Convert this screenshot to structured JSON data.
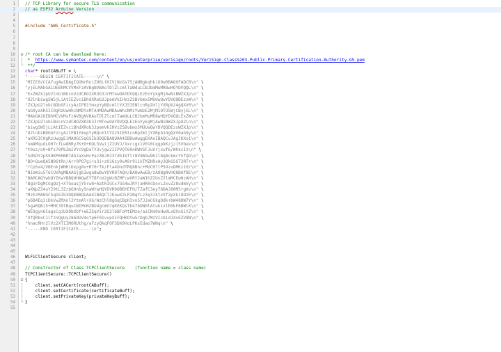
{
  "editor": {
    "active_line": 2,
    "lines": [
      {
        "n": "1",
        "fold": "",
        "t": [
          {
            "c": "comment",
            "s": "// TCP Library for secure TLS communication"
          }
        ]
      },
      {
        "n": "2",
        "fold": "",
        "t": [
          {
            "c": "comment",
            "s": "// as ESP32 "
          },
          {
            "c": "comment-squig",
            "s": "Arduino"
          },
          {
            "c": "comment",
            "s": " Version"
          }
        ]
      },
      {
        "n": "3",
        "fold": "",
        "t": []
      },
      {
        "n": "4",
        "fold": "",
        "t": []
      },
      {
        "n": "5",
        "fold": "",
        "t": [
          {
            "c": "pre",
            "s": "#include \"AWS_Certificate.h\""
          }
        ]
      },
      {
        "n": "6",
        "fold": "",
        "t": []
      },
      {
        "n": "7",
        "fold": "",
        "t": []
      },
      {
        "n": "8",
        "fold": "",
        "t": []
      },
      {
        "n": "9",
        "fold": "",
        "t": []
      },
      {
        "n": "10",
        "fold": "⊟",
        "t": [
          {
            "c": "comment",
            "s": "/* root CA can be download here:"
          }
        ]
      },
      {
        "n": "11",
        "fold": "│",
        "t": [
          {
            "c": "comment",
            "s": " *  "
          },
          {
            "c": "url",
            "s": "https://www.symantec.com/content/en/us/enterprise/verisign/roots/VeriSign-Class%203-Public-Primary-Certification-Authority-G5.pem"
          }
        ]
      },
      {
        "n": "12",
        "fold": "└",
        "t": [
          {
            "c": "comment",
            "s": " **/"
          }
        ]
      },
      {
        "n": "13",
        "fold": "",
        "t": [
          {
            "c": "kw",
            "s": "char"
          },
          {
            "c": "plain",
            "s": "* rootCABuff = \\"
          }
        ]
      },
      {
        "n": "14",
        "fold": "",
        "t": [
          {
            "c": "str",
            "s": "\"-----BEGIN CERTIFICATE-----\\n\""
          },
          {
            "c": "plain",
            "s": " \\"
          }
        ]
      },
      {
        "n": "15",
        "fold": "",
        "t": [
          {
            "c": "str",
            "s": "\"MIIE0zCCA7ugAwIBAgIQGNrRniZ96LtKIVjNzGs7SjANBgkqhkiG9w0BAQUFADCB\\n\""
          },
          {
            "c": "plain",
            "s": " \\"
          }
        ]
      },
      {
        "n": "16",
        "fold": "",
        "t": [
          {
            "c": "str",
            "s": "\"yjELMAkGA1UEBhMCVVMxFzAVBgNVBAoTDlZlcmlTaWduLCBJbmMuMR8wHQYDVQQL\\n\""
          },
          {
            "c": "plain",
            "s": " \\"
          }
        ]
      },
      {
        "n": "17",
        "fold": "",
        "t": [
          {
            "c": "str",
            "s": "\"ExZWZXJpU2lnbiBUcnVzdCBOZXR3b3JrMTowOAYDVQQLEzEoYykgMjAwNiBWZXJp\\n\""
          },
          {
            "c": "plain",
            "s": " \\"
          }
        ]
      },
      {
        "n": "18",
        "fold": "",
        "t": [
          {
            "c": "str",
            "s": "\"U2lnbiwgSW5jLiAtIEZvciBhdXRob3JpemVkIHVzZSBvbmx5MUUwQwYDVQQDEzxW\\n\""
          },
          {
            "c": "plain",
            "s": " \\"
          }
        ]
      },
      {
        "n": "19",
        "fold": "",
        "t": [
          {
            "c": "str",
            "s": "\"ZXJpU2lnbiBDbGFzcyAzIFB1YmxpYyBQcmltYXJ5IENlcnRpZmljYXRpb24gQXV0\\n\""
          },
          {
            "c": "plain",
            "s": " \\"
          }
        ]
      },
      {
        "n": "20",
        "fold": "",
        "t": [
          {
            "c": "str",
            "s": "\"aG9yaXR5IC0gRzUwHhcNMDYxMTA4MDAwMDAwWhcNMzYwNzE2MjM1OTU5WjCByjEL\\n\""
          },
          {
            "c": "plain",
            "s": " \\"
          }
        ]
      },
      {
        "n": "21",
        "fold": "",
        "t": [
          {
            "c": "str",
            "s": "\"MAkGA1UEBhMCVVMxFzAVBgNVBAoTDlZlcmlTaWduLCBJbmMuMR8wHQYDVQQLExZW\\n\""
          },
          {
            "c": "plain",
            "s": " \\"
          }
        ]
      },
      {
        "n": "22",
        "fold": "",
        "t": [
          {
            "c": "str",
            "s": "\"ZXJpU2lnbiBUcnVzdCBOZXR3b3JrMTowOAYDVQQLEzEoYykgMjAwNiBWZXJpU2ln\\n\""
          },
          {
            "c": "plain",
            "s": " \\"
          }
        ]
      },
      {
        "n": "23",
        "fold": "",
        "t": [
          {
            "c": "str",
            "s": "\"biwgSW5jLiAtIEZvciBhdXRob3JpemVkIHVzZSBvbmx5MUUwQwYDVQQDEzxWZXJp\\n\""
          },
          {
            "c": "plain",
            "s": " \\"
          }
        ]
      },
      {
        "n": "24",
        "fold": "",
        "t": [
          {
            "c": "str",
            "s": "\"U2lnbiBDbGFzcyAzIFB1YmxpYyBQcmltYXJ5IENlcnRpZmljYXRpb24gQXV0aG9y\\n\""
          },
          {
            "c": "plain",
            "s": " \\"
          }
        ]
      },
      {
        "n": "25",
        "fold": "",
        "t": [
          {
            "c": "str",
            "s": "\"aXR5IC0gRzUwggEiMA0GCSqGSIb3DQEBAQUAA4IBDwAwggEKAoIBAQCvJAgIKXo1\\n\""
          },
          {
            "c": "plain",
            "s": " \\"
          }
        ]
      },
      {
        "n": "26",
        "fold": "",
        "t": [
          {
            "c": "str",
            "s": "\"nmAMqudLO07cfLw8RRy7K+D+KQL5VwijZIUVJ/XxrcgxiV0i6CqqpkKzj/i5Vbex\\n\""
          },
          {
            "c": "plain",
            "s": " \\"
          }
        ]
      },
      {
        "n": "27",
        "fold": "",
        "t": [
          {
            "c": "str",
            "s": "\"t0uz/o9+Bfs70PbZmIVYc9gDaTY3vjgw2IIPVQT60nKWVSFJuUrjxuf6/WhkcIz\\n\""
          },
          {
            "c": "plain",
            "s": " \\"
          }
        ]
      },
      {
        "n": "28",
        "fold": "",
        "t": [
          {
            "c": "str",
            "s": "\"SdhDY2pSS9KP6HBRTdGJaXvHcPaz3BJ023tdS1bTlr8Vd6Gw9KIl8q8ckmcY5fQG\\n\""
          },
          {
            "c": "plain",
            "s": " \\"
          }
        ]
      },
      {
        "n": "29",
        "fold": "",
        "t": [
          {
            "c": "str",
            "s": "\"BO+QueQA5N06tRn/Arr0PO7gi+s3i+z016zy9vA9r911kTMZHRxAy3QkGSGT2RT+\\n\""
          },
          {
            "c": "plain",
            "s": " \\"
          }
        ]
      },
      {
        "n": "30",
        "fold": "",
        "t": [
          {
            "c": "str",
            "s": "\"rCpSx4/VBEnkjWNHiDxpg8v+R70rfk/Fla4OndTRQ8Bnc+MUCH7lP59zuDMKz10/\\n\""
          },
          {
            "c": "plain",
            "s": " \\"
          }
        ]
      },
      {
        "n": "31",
        "fold": "",
        "t": [
          {
            "c": "str",
            "s": "\"NIeWiu5T6CUVAgMBAAGjgbIwga8wDwYDVR0TAQH/BAUwAwEB/zAOBgNVHQ8BAf8E\\n\""
          },
          {
            "c": "plain",
            "s": " \\"
          }
        ]
      },
      {
        "n": "32",
        "fold": "",
        "t": [
          {
            "c": "str",
            "s": "\"BAMCAQYwbQYIKwYBBQUHAQwEYTBfoV2gWzBZMFcwVRYJaW1hZ2UvZ2lmMCEwHzAH\\n\""
          },
          {
            "c": "plain",
            "s": " \\"
          }
        ]
      },
      {
        "n": "33",
        "fold": "",
        "t": [
          {
            "c": "str",
            "s": "\"BgUrDgMCGgQUj+XTGoasjY5rw8+AatRIGCx7GS4wJRYjaHR0cDovL2xvZ28udmVy\\n\""
          },
          {
            "c": "plain",
            "s": " \\"
          }
        ]
      },
      {
        "n": "34",
        "fold": "",
        "t": [
          {
            "c": "str",
            "s": "\"aXNpZ24uY29tL3ZzbG9nby5naWYwHQYDVR0OBBYEFH/TZafC3ey78DAJ80M5+gKv\\n\""
          },
          {
            "c": "plain",
            "s": " \\"
          }
        ]
      },
      {
        "n": "35",
        "fold": "",
        "t": [
          {
            "c": "str",
            "s": "\"MzEzMA0GCSqGSIb3DQEBBQUAA4IBAQCTJEowX2LP2BqYLz3q3JktvXf2pXkiOOzE\\n\""
          },
          {
            "c": "plain",
            "s": " \\"
          }
        ]
      },
      {
        "n": "36",
        "fold": "",
        "t": [
          {
            "c": "str",
            "s": "\"p6B4Eq1iDkVwZMXnl2YtmAl+X6/WzChl8gGqCBpH3vn5fJJaCGkgDdk+bW48DW7Y\\n\""
          },
          {
            "c": "plain",
            "s": " \\"
          }
        ]
      },
      {
        "n": "37",
        "fold": "",
        "t": [
          {
            "c": "str",
            "s": "\"5gaRQBi5+MHt39tBquCWIMnNZBU4gcmU7qKEKQsTb47bDN0lAtukixlE0kF6BWlK\\n\""
          },
          {
            "c": "plain",
            "s": " \\"
          }
        ]
      },
      {
        "n": "38",
        "fold": "",
        "t": [
          {
            "c": "str",
            "s": "\"WE9gyn6CagsCqiUXObXbf+eEZSqVir2G3l6BFoMtEMze/aiCKm0oHw0LxOXnGiYZ\\n\""
          },
          {
            "c": "plain",
            "s": " \\"
          }
        ]
      },
      {
        "n": "39",
        "fold": "",
        "t": [
          {
            "c": "str",
            "s": "\"4fQRbxC1lfznQgUy286dUV4otp6F01vvpX1FQHKOtw5rDgb7MzVIcbidJ4vEZV8N\\n\""
          },
          {
            "c": "plain",
            "s": " \\"
          }
        ]
      },
      {
        "n": "40",
        "fold": "",
        "t": [
          {
            "c": "str",
            "s": "\"hnacRHr2lVz2XTIIM6RUthg/aFzyQkqFOFSDX9HoLPKsEdao7WNq\\n\""
          },
          {
            "c": "plain",
            "s": " \\"
          }
        ]
      },
      {
        "n": "41",
        "fold": "",
        "t": [
          {
            "c": "str",
            "s": "\"-----END CERTIFICATE-----\\n\""
          },
          {
            "c": "plain",
            "s": ";"
          }
        ]
      },
      {
        "n": "42",
        "fold": "",
        "t": []
      },
      {
        "n": "43",
        "fold": "",
        "t": []
      },
      {
        "n": "44",
        "fold": "",
        "t": []
      },
      {
        "n": "45",
        "fold": "",
        "t": []
      },
      {
        "n": "46",
        "fold": "",
        "t": [
          {
            "c": "plain",
            "s": "WiFiClientSecure client;"
          }
        ]
      },
      {
        "n": "47",
        "fold": "",
        "t": []
      },
      {
        "n": "48",
        "fold": "",
        "t": [
          {
            "c": "comment",
            "s": "// Constructor of Class TCPClientSecure    (function name = class name)"
          }
        ]
      },
      {
        "n": "49",
        "fold": "",
        "t": [
          {
            "c": "plain",
            "s": "TCPClientSecure::TCPClientSecure()"
          }
        ]
      },
      {
        "n": "50",
        "fold": "⊟",
        "t": [
          {
            "c": "plain",
            "s": "{"
          }
        ]
      },
      {
        "n": "51",
        "fold": "│",
        "t": [
          {
            "c": "plain",
            "s": "    client.setCACert(rootCABuff);"
          }
        ]
      },
      {
        "n": "52",
        "fold": "│",
        "t": [
          {
            "c": "plain",
            "s": "    client.setCertificate(certificateBuff);"
          }
        ]
      },
      {
        "n": "53",
        "fold": "│",
        "t": [
          {
            "c": "plain",
            "s": "    client.setPrivateKey(privateKeyBuff);"
          }
        ]
      },
      {
        "n": "54",
        "fold": "└",
        "t": [
          {
            "c": "plain",
            "s": "}"
          }
        ]
      },
      {
        "n": "55",
        "fold": "",
        "t": []
      }
    ]
  }
}
